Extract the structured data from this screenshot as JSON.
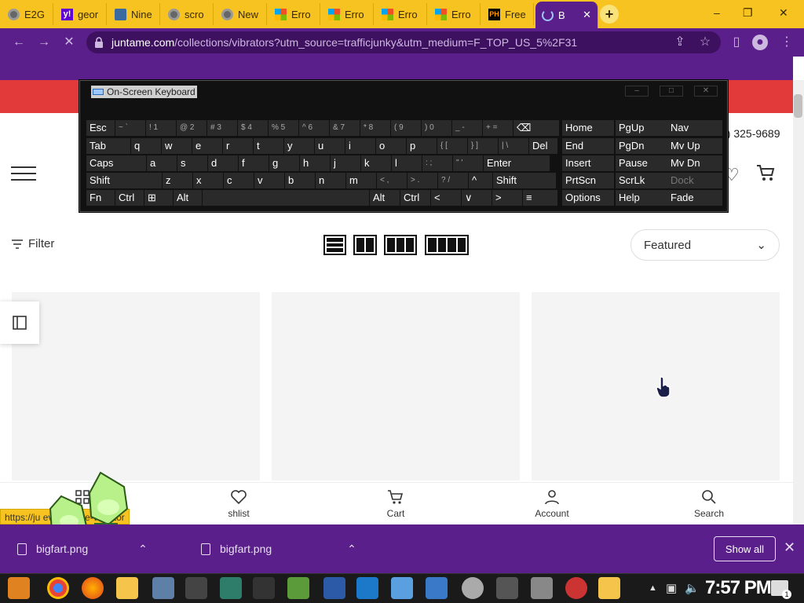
{
  "browser": {
    "tabs": [
      {
        "label": "E2G",
        "icon": "chrome-icon"
      },
      {
        "label": "geor",
        "icon": "yahoo-icon"
      },
      {
        "label": "Nine",
        "icon": "site-icon"
      },
      {
        "label": "scro",
        "icon": "chrome-icon"
      },
      {
        "label": "New",
        "icon": "chrome-icon"
      },
      {
        "label": "Erro",
        "icon": "microsoft-icon"
      },
      {
        "label": "Erro",
        "icon": "microsoft-icon"
      },
      {
        "label": "Erro",
        "icon": "microsoft-icon"
      },
      {
        "label": "Erro",
        "icon": "microsoft-icon"
      },
      {
        "label": "Free",
        "icon": "ph-icon",
        "favtext": "PH"
      },
      {
        "label": "B",
        "icon": "loading-spinner-icon",
        "active": true
      }
    ],
    "close_tab_glyph": "✕",
    "new_tab_glyph": "+",
    "yahoo_glyph": "y!",
    "url_host": "juntame.com",
    "url_path": "/collections/vibrators?utm_source=trafficjunky&utm_medium=F_TOP_US_5%2F31"
  },
  "store": {
    "phone": "9) 325-9689",
    "filter_label": "Filter",
    "sort_value": "Featured",
    "bottom_nav": [
      {
        "label": "",
        "icon": "grid-icon"
      },
      {
        "label": "shlist",
        "icon": "heart-icon"
      },
      {
        "label": "Cart",
        "icon": "cart-icon"
      },
      {
        "label": "Account",
        "icon": "account-icon"
      },
      {
        "label": "Search",
        "icon": "search-icon"
      }
    ],
    "status_link": "https://ju                                    eva-tongue-vibrator"
  },
  "downloads": {
    "items": [
      {
        "name": "bigfart.png"
      },
      {
        "name": "bigfart.png"
      }
    ],
    "show_all": "Show all",
    "close_glyph": "✕"
  },
  "osk": {
    "title": "On-Screen Keyboard",
    "rows": [
      [
        [
          "Esc",
          0
        ],
        [
          "~ `",
          1
        ],
        [
          "! 1",
          1
        ],
        [
          "@ 2",
          1
        ],
        [
          "# 3",
          1
        ],
        [
          "$ 4",
          1
        ],
        [
          "% 5",
          1
        ],
        [
          "^ 6",
          1
        ],
        [
          "& 7",
          1
        ],
        [
          "* 8",
          1
        ],
        [
          "( 9",
          1
        ],
        [
          ") 0",
          1
        ],
        [
          "_ -",
          1
        ],
        [
          "+ =",
          1
        ],
        [
          "⌫",
          0
        ],
        [
          "Home",
          0
        ],
        [
          "PgUp",
          0
        ],
        [
          "Nav",
          0
        ]
      ],
      [
        [
          "Tab",
          0
        ],
        [
          "q",
          0
        ],
        [
          "w",
          0
        ],
        [
          "e",
          0
        ],
        [
          "r",
          0
        ],
        [
          "t",
          0
        ],
        [
          "y",
          0
        ],
        [
          "u",
          0
        ],
        [
          "i",
          0
        ],
        [
          "o",
          0
        ],
        [
          "p",
          0
        ],
        [
          "{ [",
          1
        ],
        [
          "} ]",
          1
        ],
        [
          "| \\",
          1
        ],
        [
          "Del",
          0
        ],
        [
          "End",
          0
        ],
        [
          "PgDn",
          0
        ],
        [
          "Mv Up",
          0
        ]
      ],
      [
        [
          "Caps",
          0
        ],
        [
          "a",
          0
        ],
        [
          "s",
          0
        ],
        [
          "d",
          0
        ],
        [
          "f",
          0
        ],
        [
          "g",
          0
        ],
        [
          "h",
          0
        ],
        [
          "j",
          0
        ],
        [
          "k",
          0
        ],
        [
          "l",
          0
        ],
        [
          ": ;",
          1
        ],
        [
          "\" '",
          1
        ],
        [
          "Enter",
          0
        ],
        [
          "Insert",
          0
        ],
        [
          "Pause",
          0
        ],
        [
          "Mv Dn",
          0
        ]
      ],
      [
        [
          "Shift",
          0
        ],
        [
          "z",
          0
        ],
        [
          "x",
          0
        ],
        [
          "c",
          0
        ],
        [
          "v",
          0
        ],
        [
          "b",
          0
        ],
        [
          "n",
          0
        ],
        [
          "m",
          0
        ],
        [
          "< ,",
          1
        ],
        [
          "> .",
          1
        ],
        [
          "? /",
          1
        ],
        [
          "^",
          0
        ],
        [
          "Shift",
          0
        ],
        [
          "PrtScn",
          0
        ],
        [
          "ScrLk",
          0
        ],
        [
          "Dock",
          2
        ]
      ],
      [
        [
          "Fn",
          0
        ],
        [
          "Ctrl",
          0
        ],
        [
          "⊞",
          0
        ],
        [
          "Alt",
          0
        ],
        [
          "",
          0
        ],
        [
          "Alt",
          0
        ],
        [
          "Ctrl",
          0
        ],
        [
          "<",
          0
        ],
        [
          "∨",
          0
        ],
        [
          ">",
          0
        ],
        [
          "≡",
          0
        ],
        [
          "Options",
          0
        ],
        [
          "Help",
          0
        ],
        [
          "Fade",
          0
        ]
      ]
    ]
  },
  "taskbar": {
    "clock": "7:57 PM",
    "notif_count": "1"
  },
  "colors": {
    "tabstrip": "#f7c321",
    "chrome_purple": "#5a1f8a",
    "promo_red": "#e23a3a"
  }
}
